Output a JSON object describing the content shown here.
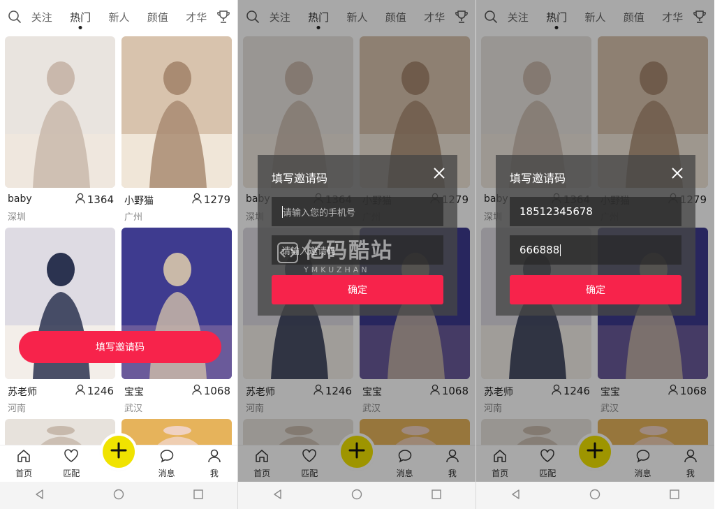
{
  "top_tabs": [
    "关注",
    "热门",
    "新人",
    "颜值",
    "才华"
  ],
  "active_tab": "热门",
  "cards": [
    {
      "name": "baby",
      "city": "深圳",
      "fans": "1364",
      "palette": [
        "#e9e4df",
        "#c9b8ac",
        "#efe7de"
      ]
    },
    {
      "name": "小野猫",
      "city": "广州",
      "fans": "1279",
      "palette": [
        "#d8c3ad",
        "#a98b72",
        "#f0e6d8"
      ]
    },
    {
      "name": "苏老师",
      "city": "河南",
      "fans": "1246",
      "palette": [
        "#dedbe3",
        "#2b3350",
        "#f3eee9"
      ]
    },
    {
      "name": "宝宝",
      "city": "武汉",
      "fans": "1068",
      "palette": [
        "#3e3b8f",
        "#c9b9a8",
        "#6a5a9a"
      ]
    },
    {
      "name": "",
      "city": "",
      "fans": "",
      "palette": [
        "#e7e2dc",
        "#c7b9ac",
        "#f1ece6"
      ]
    },
    {
      "name": "",
      "city": "",
      "fans": "",
      "palette": [
        "#e6b35b",
        "#f0d2c2",
        "#d99c3a"
      ]
    }
  ],
  "invite_button": "填写邀请码",
  "bottom_nav": [
    {
      "label": "首页",
      "icon": "home-icon"
    },
    {
      "label": "匹配",
      "icon": "heart-icon"
    },
    {
      "label": "消息",
      "icon": "message-icon"
    },
    {
      "label": "我",
      "icon": "profile-icon"
    }
  ],
  "plus_icon": "plus-icon",
  "dialog": {
    "title": "填写邀请码",
    "phone_placeholder": "请输入您的手机号",
    "code_placeholder": "请输入邀请码",
    "confirm": "确定",
    "phone_value": "18512345678",
    "code_value": "666888"
  },
  "watermark": {
    "cn": "亿码酷站",
    "en": "YMKUZHAN"
  },
  "accent": "#f7234b",
  "plus_color": "#f0e300"
}
